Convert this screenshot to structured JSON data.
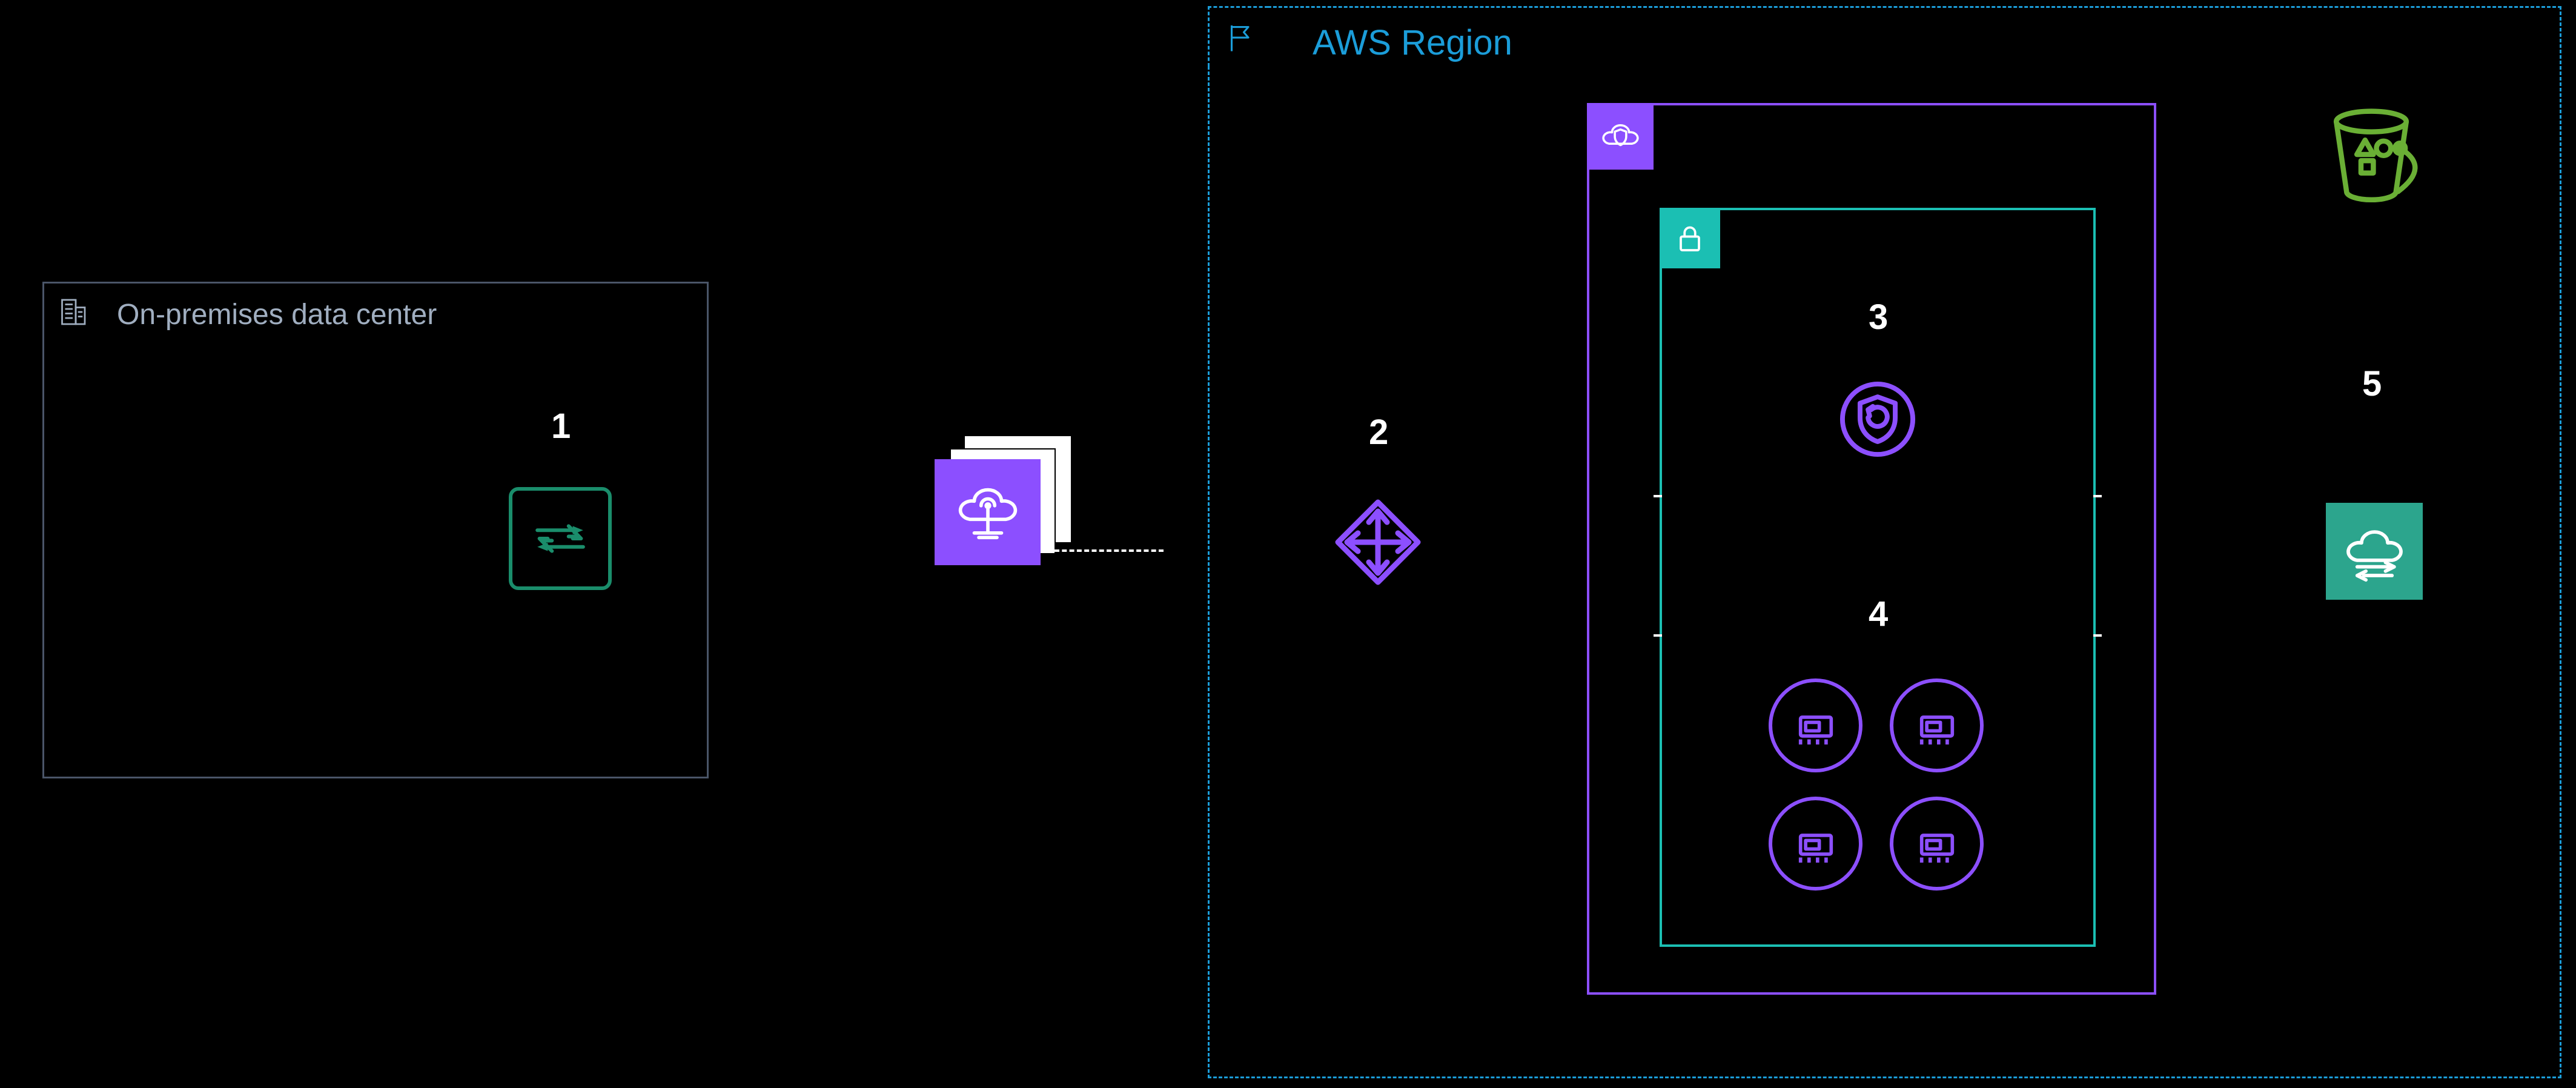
{
  "onprem": {
    "title": "On-premises data center"
  },
  "region": {
    "title": "AWS Region"
  },
  "labels": {
    "n1": "1",
    "n2": "2",
    "n3": "3",
    "n4": "4",
    "n5": "5"
  },
  "icons": {
    "onprem_badge": "building-icon",
    "datasync_agent": "datasync-agent-icon",
    "direct_connect": "direct-connect-icon",
    "region_badge": "flag-icon",
    "vpc_endpoint": "vpc-endpoint-icon",
    "vpc_badge": "vpc-cloud-shield-icon",
    "subnet_badge": "lock-icon",
    "mgn_shield": "mgn-shield-icon",
    "eni": "eni-icon",
    "s3": "s3-bucket-icon",
    "datasync": "datasync-cloud-icon"
  },
  "colors": {
    "region_blue": "#1b9dd9",
    "vpc_purple": "#8c4fff",
    "subnet_teal": "#1bbfb3",
    "s3_green": "#6aaf35",
    "datasync_green": "#2ca58d",
    "onprem_grey": "#4a5568"
  }
}
